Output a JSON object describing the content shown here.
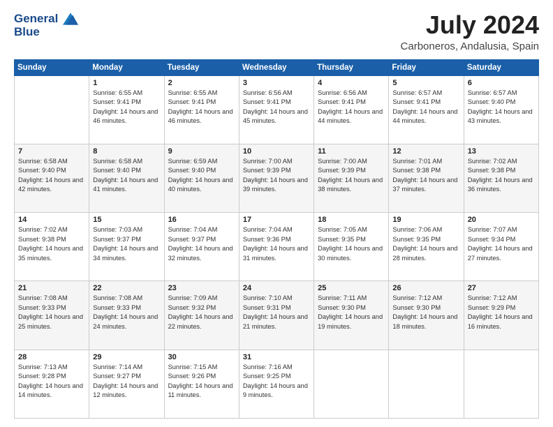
{
  "logo": {
    "line1": "General",
    "line2": "Blue"
  },
  "title": {
    "month_year": "July 2024",
    "location": "Carboneros, Andalusia, Spain"
  },
  "headers": [
    "Sunday",
    "Monday",
    "Tuesday",
    "Wednesday",
    "Thursday",
    "Friday",
    "Saturday"
  ],
  "weeks": [
    [
      {
        "day": "",
        "info": ""
      },
      {
        "day": "1",
        "info": "Sunrise: 6:55 AM\nSunset: 9:41 PM\nDaylight: 14 hours and 46 minutes."
      },
      {
        "day": "2",
        "info": "Sunrise: 6:55 AM\nSunset: 9:41 PM\nDaylight: 14 hours and 46 minutes."
      },
      {
        "day": "3",
        "info": "Sunrise: 6:56 AM\nSunset: 9:41 PM\nDaylight: 14 hours and 45 minutes."
      },
      {
        "day": "4",
        "info": "Sunrise: 6:56 AM\nSunset: 9:41 PM\nDaylight: 14 hours and 44 minutes."
      },
      {
        "day": "5",
        "info": "Sunrise: 6:57 AM\nSunset: 9:41 PM\nDaylight: 14 hours and 44 minutes."
      },
      {
        "day": "6",
        "info": "Sunrise: 6:57 AM\nSunset: 9:40 PM\nDaylight: 14 hours and 43 minutes."
      }
    ],
    [
      {
        "day": "7",
        "info": "Sunrise: 6:58 AM\nSunset: 9:40 PM\nDaylight: 14 hours and 42 minutes."
      },
      {
        "day": "8",
        "info": "Sunrise: 6:58 AM\nSunset: 9:40 PM\nDaylight: 14 hours and 41 minutes."
      },
      {
        "day": "9",
        "info": "Sunrise: 6:59 AM\nSunset: 9:40 PM\nDaylight: 14 hours and 40 minutes."
      },
      {
        "day": "10",
        "info": "Sunrise: 7:00 AM\nSunset: 9:39 PM\nDaylight: 14 hours and 39 minutes."
      },
      {
        "day": "11",
        "info": "Sunrise: 7:00 AM\nSunset: 9:39 PM\nDaylight: 14 hours and 38 minutes."
      },
      {
        "day": "12",
        "info": "Sunrise: 7:01 AM\nSunset: 9:38 PM\nDaylight: 14 hours and 37 minutes."
      },
      {
        "day": "13",
        "info": "Sunrise: 7:02 AM\nSunset: 9:38 PM\nDaylight: 14 hours and 36 minutes."
      }
    ],
    [
      {
        "day": "14",
        "info": "Sunrise: 7:02 AM\nSunset: 9:38 PM\nDaylight: 14 hours and 35 minutes."
      },
      {
        "day": "15",
        "info": "Sunrise: 7:03 AM\nSunset: 9:37 PM\nDaylight: 14 hours and 34 minutes."
      },
      {
        "day": "16",
        "info": "Sunrise: 7:04 AM\nSunset: 9:37 PM\nDaylight: 14 hours and 32 minutes."
      },
      {
        "day": "17",
        "info": "Sunrise: 7:04 AM\nSunset: 9:36 PM\nDaylight: 14 hours and 31 minutes."
      },
      {
        "day": "18",
        "info": "Sunrise: 7:05 AM\nSunset: 9:35 PM\nDaylight: 14 hours and 30 minutes."
      },
      {
        "day": "19",
        "info": "Sunrise: 7:06 AM\nSunset: 9:35 PM\nDaylight: 14 hours and 28 minutes."
      },
      {
        "day": "20",
        "info": "Sunrise: 7:07 AM\nSunset: 9:34 PM\nDaylight: 14 hours and 27 minutes."
      }
    ],
    [
      {
        "day": "21",
        "info": "Sunrise: 7:08 AM\nSunset: 9:33 PM\nDaylight: 14 hours and 25 minutes."
      },
      {
        "day": "22",
        "info": "Sunrise: 7:08 AM\nSunset: 9:33 PM\nDaylight: 14 hours and 24 minutes."
      },
      {
        "day": "23",
        "info": "Sunrise: 7:09 AM\nSunset: 9:32 PM\nDaylight: 14 hours and 22 minutes."
      },
      {
        "day": "24",
        "info": "Sunrise: 7:10 AM\nSunset: 9:31 PM\nDaylight: 14 hours and 21 minutes."
      },
      {
        "day": "25",
        "info": "Sunrise: 7:11 AM\nSunset: 9:30 PM\nDaylight: 14 hours and 19 minutes."
      },
      {
        "day": "26",
        "info": "Sunrise: 7:12 AM\nSunset: 9:30 PM\nDaylight: 14 hours and 18 minutes."
      },
      {
        "day": "27",
        "info": "Sunrise: 7:12 AM\nSunset: 9:29 PM\nDaylight: 14 hours and 16 minutes."
      }
    ],
    [
      {
        "day": "28",
        "info": "Sunrise: 7:13 AM\nSunset: 9:28 PM\nDaylight: 14 hours and 14 minutes."
      },
      {
        "day": "29",
        "info": "Sunrise: 7:14 AM\nSunset: 9:27 PM\nDaylight: 14 hours and 12 minutes."
      },
      {
        "day": "30",
        "info": "Sunrise: 7:15 AM\nSunset: 9:26 PM\nDaylight: 14 hours and 11 minutes."
      },
      {
        "day": "31",
        "info": "Sunrise: 7:16 AM\nSunset: 9:25 PM\nDaylight: 14 hours and 9 minutes."
      },
      {
        "day": "",
        "info": ""
      },
      {
        "day": "",
        "info": ""
      },
      {
        "day": "",
        "info": ""
      }
    ]
  ]
}
